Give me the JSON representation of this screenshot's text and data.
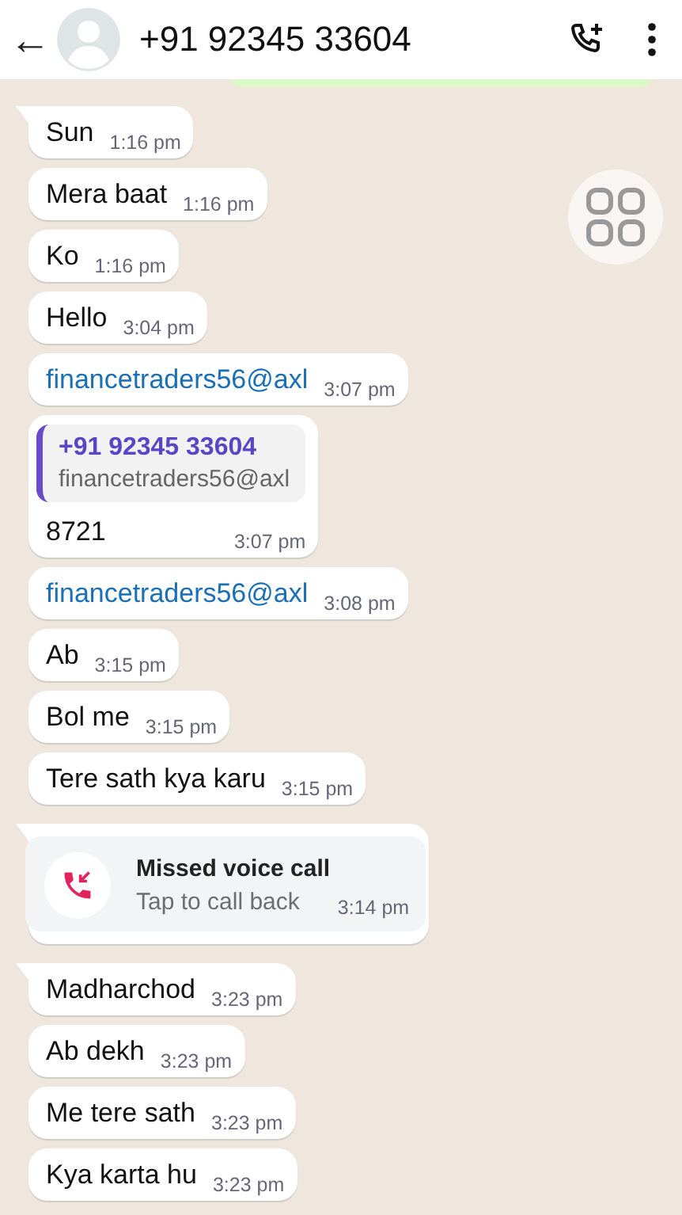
{
  "header": {
    "back": "←",
    "title": "+91 92345 33604"
  },
  "messages": [
    {
      "kind": "text",
      "text": "Sun",
      "time": "1:16 pm",
      "tail": true
    },
    {
      "kind": "text",
      "text": "Mera  baat",
      "time": "1:16 pm",
      "tail": false
    },
    {
      "kind": "text",
      "text": "Ko",
      "time": "1:16 pm",
      "tail": false
    },
    {
      "kind": "text",
      "text": "Hello",
      "time": "3:04 pm",
      "tail": false
    },
    {
      "kind": "link",
      "text": "financetraders56@axl",
      "time": "3:07 pm",
      "tail": false
    },
    {
      "kind": "quoted",
      "quote_title": "+91 92345 33604",
      "quote_text": "financetraders56@axl",
      "text": "8721",
      "time": "3:07 pm",
      "tail": false
    },
    {
      "kind": "link",
      "text": "financetraders56@axl",
      "time": "3:08 pm",
      "tail": false
    },
    {
      "kind": "text",
      "text": "Ab",
      "time": "3:15 pm",
      "tail": false
    },
    {
      "kind": "text",
      "text": "Bol me",
      "time": "3:15 pm",
      "tail": false
    },
    {
      "kind": "text",
      "text": "Tere sath kya karu",
      "time": "3:15 pm",
      "tail": false
    },
    {
      "kind": "call",
      "title": "Missed voice call",
      "text": "Tap to call back",
      "time": "3:14 pm",
      "tail": true
    },
    {
      "kind": "text",
      "text": "Madharchod",
      "time": "3:23 pm",
      "tail": true
    },
    {
      "kind": "text",
      "text": "Ab dekh",
      "time": "3:23 pm",
      "tail": false
    },
    {
      "kind": "text",
      "text": "Me tere sath",
      "time": "3:23 pm",
      "tail": false
    },
    {
      "kind": "text",
      "text": "Kya karta hu",
      "time": "3:23 pm",
      "tail": false
    }
  ]
}
